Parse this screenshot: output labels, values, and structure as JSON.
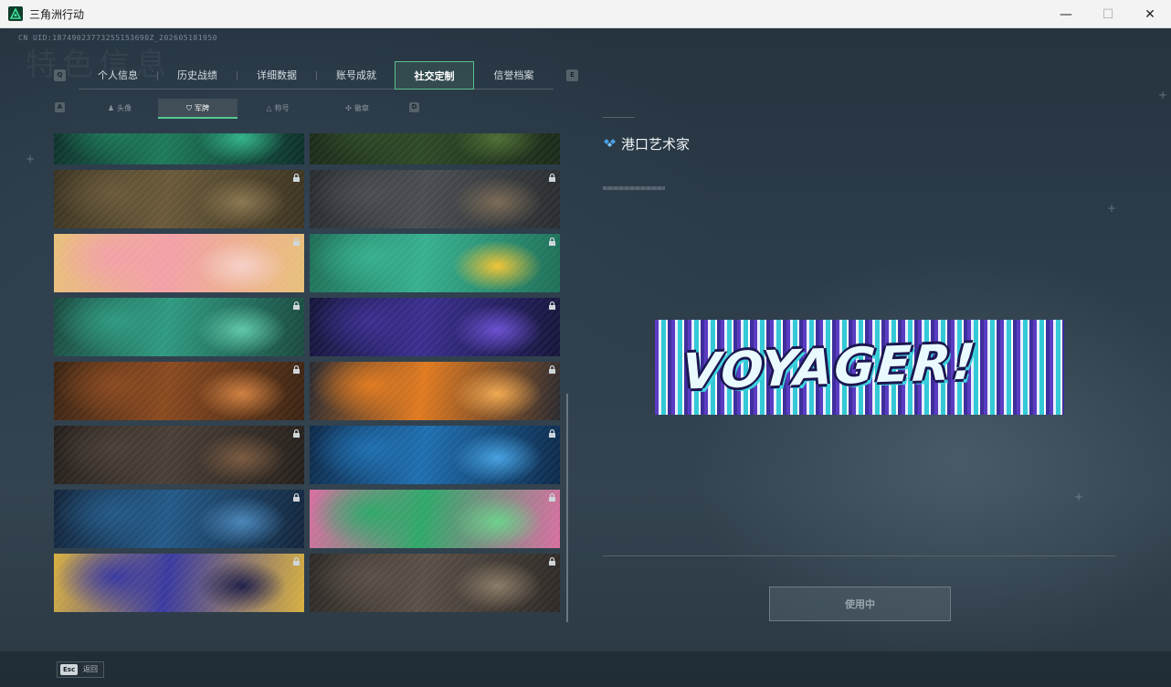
{
  "window": {
    "title": "三角洲行动",
    "controls": {
      "minimize": "—",
      "maximize": "☐",
      "close": "✕"
    }
  },
  "uid": "CN UID:18749023773255153690Z_202605181950",
  "watermark": "特色信息",
  "tabs": {
    "left_key": "Q",
    "right_key": "E",
    "items": [
      {
        "label": "个人信息"
      },
      {
        "label": "历史战绩"
      },
      {
        "label": "详细数据"
      },
      {
        "label": "账号成就"
      },
      {
        "label": "社交定制"
      },
      {
        "label": "信誉档案"
      }
    ],
    "active_index": 4
  },
  "subtabs": {
    "left_key": "A",
    "right_key": "D",
    "items": [
      {
        "label": "头像",
        "icon": "person-icon"
      },
      {
        "label": "军牌",
        "icon": "dogtag-icon"
      },
      {
        "label": "称号",
        "icon": "triangle-icon"
      },
      {
        "label": "徽章",
        "icon": "badge-icon"
      }
    ],
    "active_index": 1
  },
  "cards": [
    {
      "name": "card-green-sniper",
      "colors": [
        "#1e7a5a",
        "#0e2f2b",
        "#33b38a"
      ],
      "locked": false
    },
    {
      "name": "card-jungle-soldier",
      "colors": [
        "#2f4a28",
        "#1c2b1a",
        "#4f6e35"
      ],
      "locked": false
    },
    {
      "name": "card-desert-helicopter",
      "colors": [
        "#6a5a3a",
        "#3c3422",
        "#8a7650"
      ],
      "locked": true
    },
    {
      "name": "card-tank-battle",
      "colors": [
        "#4a4e52",
        "#2a2d30",
        "#7a6a55"
      ],
      "locked": true
    },
    {
      "name": "card-pink-cats",
      "colors": [
        "#f2a0a8",
        "#e8c07a",
        "#f6d0c8"
      ],
      "locked": true
    },
    {
      "name": "card-green-thumbs",
      "colors": [
        "#37b08f",
        "#1f6f57",
        "#f0c435"
      ],
      "locked": true
    },
    {
      "name": "card-teal-drone",
      "colors": [
        "#2f9a80",
        "#1b4a40",
        "#5fc7a8"
      ],
      "locked": true
    },
    {
      "name": "card-purple-lightning",
      "colors": [
        "#3b2f8f",
        "#15163a",
        "#6b4fd0"
      ],
      "locked": true
    },
    {
      "name": "card-orange-firefight",
      "colors": [
        "#8a4a20",
        "#3a2414",
        "#d08040"
      ],
      "locked": true
    },
    {
      "name": "card-orange-burst-robot",
      "colors": [
        "#e07a20",
        "#2a2a30",
        "#f0a850"
      ],
      "locked": true
    },
    {
      "name": "card-ruins-soldier",
      "colors": [
        "#4a4038",
        "#26201c",
        "#7a5a40"
      ],
      "locked": true
    },
    {
      "name": "card-blue-knife",
      "colors": [
        "#1f6fb0",
        "#0e2a4a",
        "#45a0e0"
      ],
      "locked": true
    },
    {
      "name": "card-blue-spider-robot",
      "colors": [
        "#245a88",
        "#14263c",
        "#4a86b8"
      ],
      "locked": true
    },
    {
      "name": "card-green-pink-plants",
      "colors": [
        "#2fa86a",
        "#d86fa0",
        "#6ad08a"
      ],
      "locked": true
    },
    {
      "name": "card-yellow-purple-tower",
      "colors": [
        "#3a3aa0",
        "#d8b040",
        "#20204a"
      ],
      "locked": true
    },
    {
      "name": "card-wasteland-debris",
      "colors": [
        "#5a5048",
        "#2e2a26",
        "#8a7a66"
      ],
      "locked": true
    }
  ],
  "detail": {
    "title": "港口艺术家",
    "title_icon": "diamond-icon",
    "banner_text": "VOYAGER!",
    "button_label": "使用中"
  },
  "footer": {
    "esc_key": "Esc",
    "esc_label": "返回"
  }
}
